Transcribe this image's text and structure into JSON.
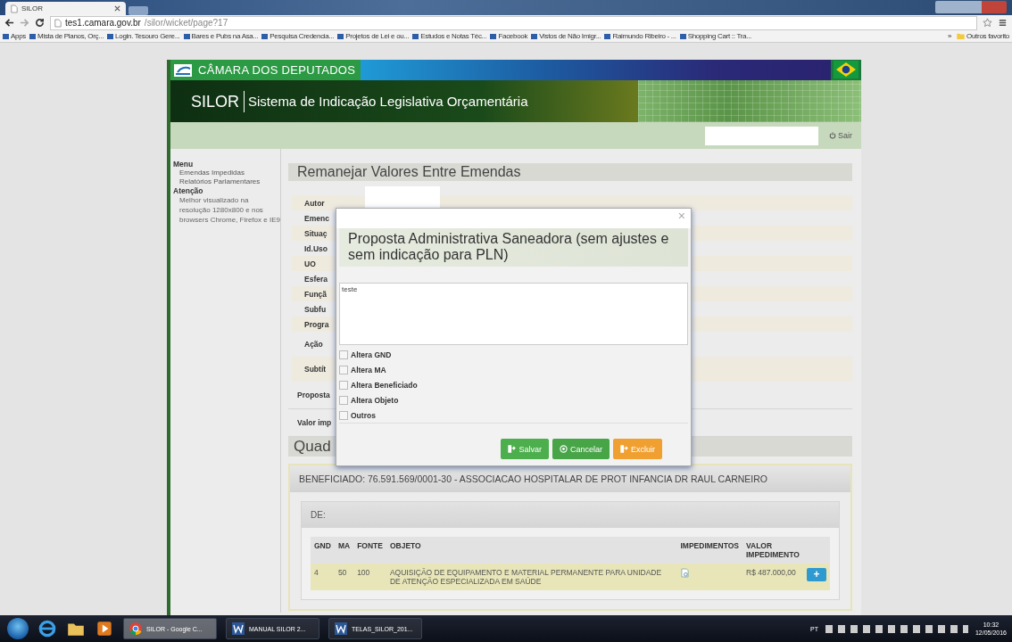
{
  "browser": {
    "tab_title": "SILOR",
    "url_host": "tes1.camara.gov.br",
    "url_path": "/silor/wicket/page?17",
    "bookmarks": [
      "Apps",
      "Mista de Planos, Orç...",
      "Login. Tesouro Gere...",
      "Bares e Pubs na Asa...",
      "Pesquisa Credencia...",
      "Projetos de Lei e ou...",
      "Estudos e Notas Téc...",
      "Facebook",
      "Vistos de Não Imigr...",
      "Raimundo Ribeiro - ...",
      "Shopping Cart :: Tra..."
    ],
    "bookmarks_overflow": "»",
    "other_bookmarks": "Outros favorito"
  },
  "header": {
    "org": "CÂMARA DOS DEPUTADOS",
    "app_short": "SILOR",
    "app_name": "Sistema de Indicação Legislativa Orçamentária",
    "logout": "Sair"
  },
  "sidebar": {
    "menu_title": "Menu",
    "menu_items": [
      "Emendas Impedidas",
      "Relatórios Parlamentares"
    ],
    "notice_title": "Atenção",
    "notice": "Melhor visualizado na resolução 1280x800 e nos browsers Chrome, Firefox e IE9"
  },
  "page_title": "Remanejar Valores Entre Emendas",
  "form_labels": [
    {
      "label": "Autor",
      "kind": "field"
    },
    {
      "label": "Emenc",
      "kind": "field"
    },
    {
      "label": "Situaç",
      "kind": "field"
    },
    {
      "label": "Id.Uso",
      "kind": "field"
    },
    {
      "label": "UO",
      "kind": "field"
    },
    {
      "label": "Esfera",
      "kind": "field"
    },
    {
      "label": "Funçã",
      "kind": "field"
    },
    {
      "label": "Subfu",
      "kind": "field"
    },
    {
      "label": "Progra",
      "kind": "field"
    },
    {
      "label": "Ação",
      "kind": "tall"
    },
    {
      "label": "Subtít",
      "kind": "tall"
    }
  ],
  "summary_labels": [
    "Proposta",
    "Valor imp"
  ],
  "section_heading": "Quad",
  "modal": {
    "close": "×",
    "title": "Proposta Administrativa Saneadora (sem ajustes e sem indicação para PLN)",
    "note": "teste",
    "options": [
      {
        "label": "Altera GND",
        "checked": false
      },
      {
        "label": "Altera MA",
        "checked": false
      },
      {
        "label": "Altera Beneficiado",
        "checked": false
      },
      {
        "label": "Altera Objeto",
        "checked": false
      },
      {
        "label": "Outros",
        "checked": false
      }
    ],
    "buttons": [
      {
        "label": "Salvar",
        "kind": "save"
      },
      {
        "label": "Cancelar",
        "kind": "cancel"
      },
      {
        "label": "Excluir",
        "kind": "delete"
      }
    ]
  },
  "beneficiary": {
    "title": "BENEFICIADO: 76.591.569/0001-30 - ASSOCIACAO HOSPITALAR DE PROT INFANCIA DR RAUL CARNEIRO",
    "panel_title": "DE:",
    "columns": [
      "GND",
      "MA",
      "FONTE",
      "OBJETO",
      "IMPEDIMENTOS",
      "VALOR IMPEDIMENTO"
    ],
    "rows": [
      {
        "gnd": "4",
        "ma": "50",
        "fonte": "100",
        "objeto": "AQUISIÇÃO DE EQUIPAMENTO E MATERIAL PERMANENTE PARA UNIDADE DE ATENÇÃO ESPECIALIZADA EM SAÚDE",
        "valor": "R$ 487.000,00",
        "add": "+"
      }
    ]
  },
  "taskbar": {
    "windows": [
      {
        "label": "SILOR - Google C...",
        "kind": "chrome",
        "selected": true
      },
      {
        "label": "MANUAL SILOR 2...",
        "kind": "word",
        "selected": false
      },
      {
        "label": "TELAS_SILOR_201...",
        "kind": "word",
        "selected": false
      }
    ],
    "language": "PT",
    "time": "10:32",
    "date": "12/05/2016"
  }
}
